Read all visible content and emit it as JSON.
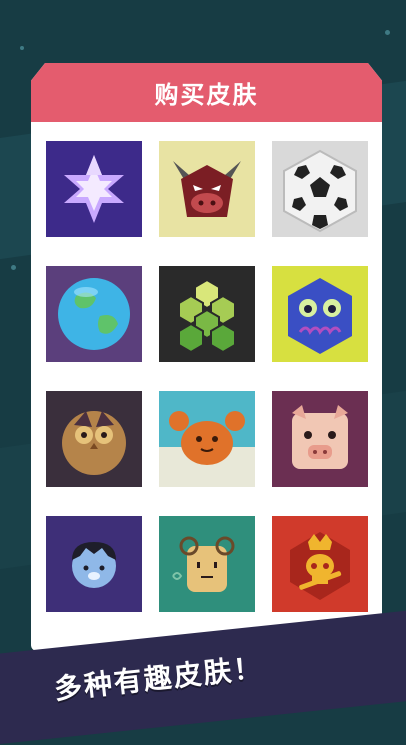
{
  "header": {
    "title": "购买皮肤"
  },
  "banner": {
    "text": "多种有趣皮肤！"
  },
  "skins": [
    {
      "name": "skin-star-crystal",
      "icon": "star-crystal-icon",
      "bg": "#3d2a8a"
    },
    {
      "name": "skin-bull",
      "icon": "bull-icon",
      "bg": "#e8e3a3"
    },
    {
      "name": "skin-soccer-ball",
      "icon": "soccer-ball-icon",
      "bg": "#d9d9d9"
    },
    {
      "name": "skin-earth",
      "icon": "earth-icon",
      "bg": "#5b3f7c"
    },
    {
      "name": "skin-honeycomb",
      "icon": "honeycomb-icon",
      "bg": "#2a2a2a"
    },
    {
      "name": "skin-blue-monster",
      "icon": "blue-monster-icon",
      "bg": "#d7e040"
    },
    {
      "name": "skin-owl",
      "icon": "owl-icon",
      "bg": "#3a2f3c"
    },
    {
      "name": "skin-crab",
      "icon": "crab-icon",
      "bg": "#4fb7c8"
    },
    {
      "name": "skin-pig",
      "icon": "pig-icon",
      "bg": "#6b2f52"
    },
    {
      "name": "skin-cat",
      "icon": "cat-icon",
      "bg": "#3e2f78"
    },
    {
      "name": "skin-sheep",
      "icon": "sheep-icon",
      "bg": "#2f8f7c"
    },
    {
      "name": "skin-skull",
      "icon": "skull-icon",
      "bg": "#d03a2b"
    }
  ]
}
